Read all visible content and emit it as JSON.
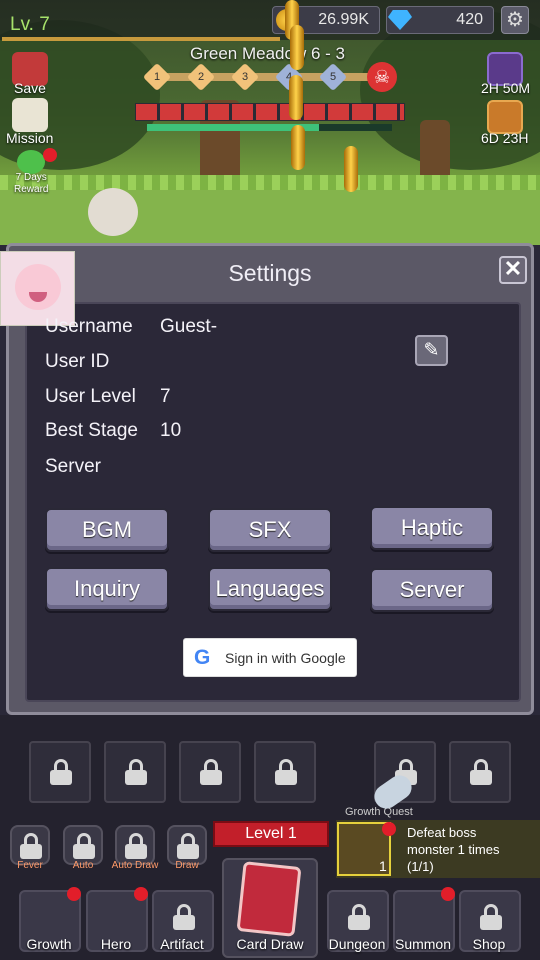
{
  "hud": {
    "level": "Lv. 7",
    "gold": "26.99K",
    "gems": "420",
    "stage": "Green Meadow 6 - 3",
    "stage_nodes": [
      "1",
      "2",
      "3",
      "4",
      "5"
    ],
    "timers": {
      "first": "2H 50M",
      "second": "6D 23H"
    }
  },
  "side_menu": {
    "save": "Save",
    "mission": "Mission",
    "reward_line1": "7 Days",
    "reward_line2": "Reward"
  },
  "settings": {
    "title": "Settings",
    "rows": [
      {
        "label": "Username",
        "value": "Guest-"
      },
      {
        "label": "User ID",
        "value": ""
      },
      {
        "label": "User Level",
        "value": "7"
      },
      {
        "label": "Best Stage",
        "value": "10"
      },
      {
        "label": "Server",
        "value": ""
      }
    ],
    "buttons": [
      "BGM",
      "SFX",
      "Haptic",
      "Inquiry",
      "Languages",
      "Server"
    ],
    "google_signin": "Sign in with Google"
  },
  "bottom": {
    "tools": [
      "Fever",
      "Auto",
      "Auto Draw",
      "Draw"
    ],
    "level_banner": "Level 1",
    "quest_label": "Growth Quest",
    "quest_count": "1",
    "quest_line1": "Defeat boss",
    "quest_line2": "monster 1 times",
    "quest_line3": "(1/1)",
    "nav": [
      "Growth",
      "Hero",
      "Artifact",
      "Card Draw",
      "Dungeon",
      "Summon",
      "Shop"
    ]
  },
  "colors": {
    "level_green": "#a7e36b",
    "panel": "#5b5866",
    "button": "#8a86a6",
    "alert_red": "#e21e2a"
  }
}
